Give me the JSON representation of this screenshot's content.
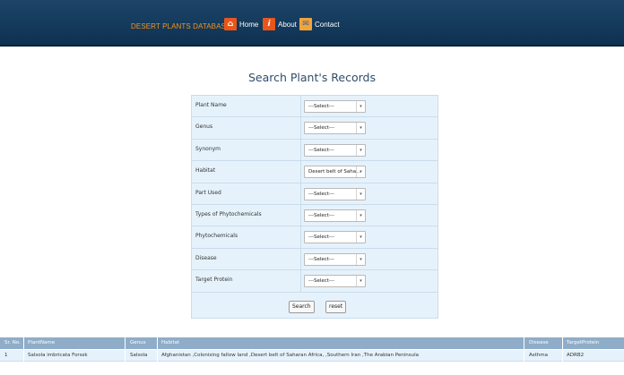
{
  "header": {
    "brand": "DESERT PLANTS DATABASE",
    "nav": [
      {
        "label": "Home",
        "icon": "home-icon",
        "color": "#e8561c"
      },
      {
        "label": "About",
        "icon": "info-icon",
        "color": "#e8561c"
      },
      {
        "label": "Contact",
        "icon": "contact-icon",
        "color": "#f1a43a"
      }
    ]
  },
  "search": {
    "title": "Search Plant's Records",
    "fields": [
      {
        "label": "Plant Name",
        "value": "---Select---"
      },
      {
        "label": "Genus",
        "value": "---Select---"
      },
      {
        "label": "Synonym",
        "value": "---Select---"
      },
      {
        "label": "Habitat",
        "value": "Desert belt of Saha..."
      },
      {
        "label": "Part Used",
        "value": "---Select---"
      },
      {
        "label": "Types of Phytochemicals",
        "value": "---Select---"
      },
      {
        "label": "Phytochemicals",
        "value": "---Select---"
      },
      {
        "label": "Disease",
        "value": "---Select---"
      },
      {
        "label": "Target Protein",
        "value": "---Select---"
      }
    ],
    "search_label": "Search",
    "reset_label": "reset"
  },
  "results": {
    "columns": [
      "Sr. No.",
      "PlantName",
      "Genus",
      "Habitat",
      "Disease",
      "TargetProtein"
    ],
    "rows": [
      [
        "1",
        "Salsola imbricata Forssk",
        "Salsola",
        "Afghanistan ,Colonising fallow land ,Desert belt of Saharan Africa, ,Southern Iran ,The Arabian Peninsula",
        "Asthma",
        "ADRB2"
      ]
    ]
  },
  "colors": {
    "header_bg": "#12395b",
    "brand": "#f7941d",
    "form_bg": "#e6f2fb",
    "table_header_bg": "#8fadc8"
  }
}
